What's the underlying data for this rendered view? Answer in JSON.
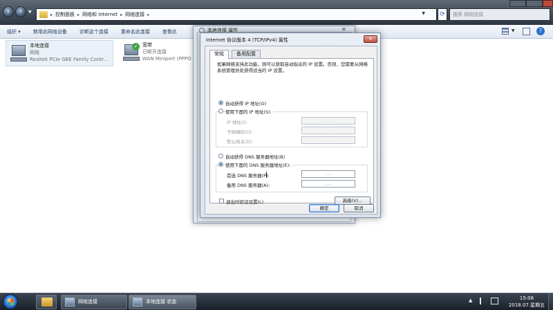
{
  "explorer": {
    "breadcrumbs": [
      "控制面板",
      "网络和 Internet",
      "网络连接"
    ],
    "search_placeholder": "搜索 网络连接",
    "toolbar": [
      "组织 ▾",
      "禁用此网络设备",
      "诊断这个连接",
      "重命名此连接",
      "查看此"
    ],
    "connections": [
      {
        "name": "本地连接",
        "status": "网络",
        "device": "Realtek PCIe GBE Family Contr..."
      },
      {
        "name": "宽带",
        "status": "已断开连接",
        "device": "WAN Miniport (PPPO"
      }
    ]
  },
  "status_window": {
    "title": "本地连接 属性",
    "close": "✕"
  },
  "dialog": {
    "title": "Internet 协议版本 4 (TCP/IPv4) 属性",
    "close": "✕",
    "tabs": [
      "常规",
      "备用配置"
    ],
    "intro": "如果网络支持此功能，则可以获取自动指派的 IP 设置。否则，您需要从网络系统管理员处获得适当的 IP 设置。",
    "ip_auto": "自动获得 IP 地址(O)",
    "ip_manual": "使用下面的 IP 地址(S):",
    "ip_fields": [
      {
        "label": "IP 地址(I):",
        "value": ". . ."
      },
      {
        "label": "子网掩码(U):",
        "value": ". . ."
      },
      {
        "label": "默认网关(D):",
        "value": ". . ."
      }
    ],
    "dns_auto": "自动获得 DNS 服务器地址(B)",
    "dns_manual": "使用下面的 DNS 服务器地址(E):",
    "dns_fields": [
      {
        "label": "首选 DNS 服务器(P):",
        "value": ". . ."
      },
      {
        "label": "备用 DNS 服务器(A):",
        "value": ". . ."
      }
    ],
    "validate_on_exit": "退出时验证设置(L)",
    "advanced_button": "高级(V)...",
    "ok_button": "确定",
    "cancel_button": "取消",
    "selected_ip_mode": "auto",
    "selected_dns_mode": "manual"
  },
  "taskbar": {
    "tasks": [
      "网络连接",
      "本地连接 状态"
    ],
    "time": "15:08",
    "date": "2018.07.星期五"
  }
}
